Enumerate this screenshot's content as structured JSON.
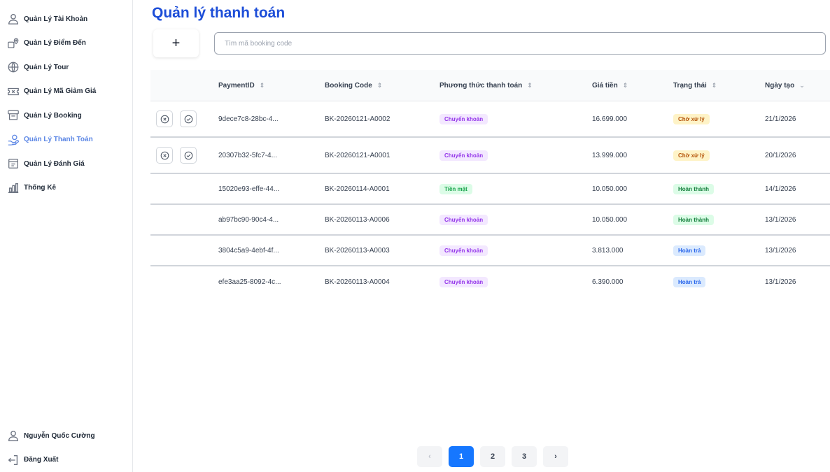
{
  "sidebar": {
    "items": [
      {
        "label": "Quản Lý Tài Khoản",
        "icon": "user-icon"
      },
      {
        "label": "Quản Lý Điểm Đến",
        "icon": "destination-icon"
      },
      {
        "label": "Quản Lý Tour",
        "icon": "tour-icon"
      },
      {
        "label": "Quản Lý Mã Giảm Giá",
        "icon": "voucher-icon"
      },
      {
        "label": "Quản Lý Booking",
        "icon": "booking-icon"
      },
      {
        "label": "Quản Lý Thanh Toán",
        "icon": "payment-icon",
        "active": true
      },
      {
        "label": "Quản Lý Đánh Giá",
        "icon": "review-icon"
      },
      {
        "label": "Thống Kê",
        "icon": "chart-icon"
      }
    ],
    "user_name": "Nguyễn Quốc Cường",
    "logout_label": "Đăng Xuất"
  },
  "main": {
    "title": "Quản lý thanh toán",
    "add_label": "+",
    "search_placeholder": "Tìm mã booking code",
    "columns": [
      "PaymentID",
      "Booking Code",
      "Phương thức thanh toán",
      "Giá tiền",
      "Trạng thái",
      "Ngày tạo"
    ],
    "rows": [
      {
        "id": "9dece7c8-28bc-4...",
        "code": "BK-20260121-A0002",
        "method": "Chuyển khoản",
        "price": "16.699.000",
        "status": "Chờ xử lý",
        "date": "21/1/2026",
        "actions": true
      },
      {
        "id": "20307b32-5fc7-4...",
        "code": "BK-20260121-A0001",
        "method": "Chuyển khoản",
        "price": "13.999.000",
        "status": "Chờ xử lý",
        "date": "20/1/2026",
        "actions": true
      },
      {
        "id": "15020e93-effe-44...",
        "code": "BK-20260114-A0001",
        "method": "Tiền mặt",
        "price": "10.050.000",
        "status": "Hoàn thành",
        "date": "14/1/2026",
        "actions": false
      },
      {
        "id": "ab97bc90-90c4-4...",
        "code": "BK-20260113-A0006",
        "method": "Chuyển khoản",
        "price": "10.050.000",
        "status": "Hoàn thành",
        "date": "13/1/2026",
        "actions": false
      },
      {
        "id": "3804c5a9-4ebf-4f...",
        "code": "BK-20260113-A0003",
        "method": "Chuyển khoản",
        "price": "3.813.000",
        "status": "Hoàn trả",
        "date": "13/1/2026",
        "actions": false
      },
      {
        "id": "efe3aa25-8092-4c...",
        "code": "BK-20260113-A0004",
        "method": "Chuyển khoản",
        "price": "6.390.000",
        "status": "Hoàn trả",
        "date": "13/1/2026",
        "actions": false
      }
    ]
  },
  "pagination": {
    "prev": "‹",
    "pages": [
      "1",
      "2",
      "3"
    ],
    "current": "1",
    "next": "›"
  },
  "colors": {
    "accent": "#1d4ed8",
    "active_nav": "#5b86e5",
    "page_active": "#1677ff"
  }
}
